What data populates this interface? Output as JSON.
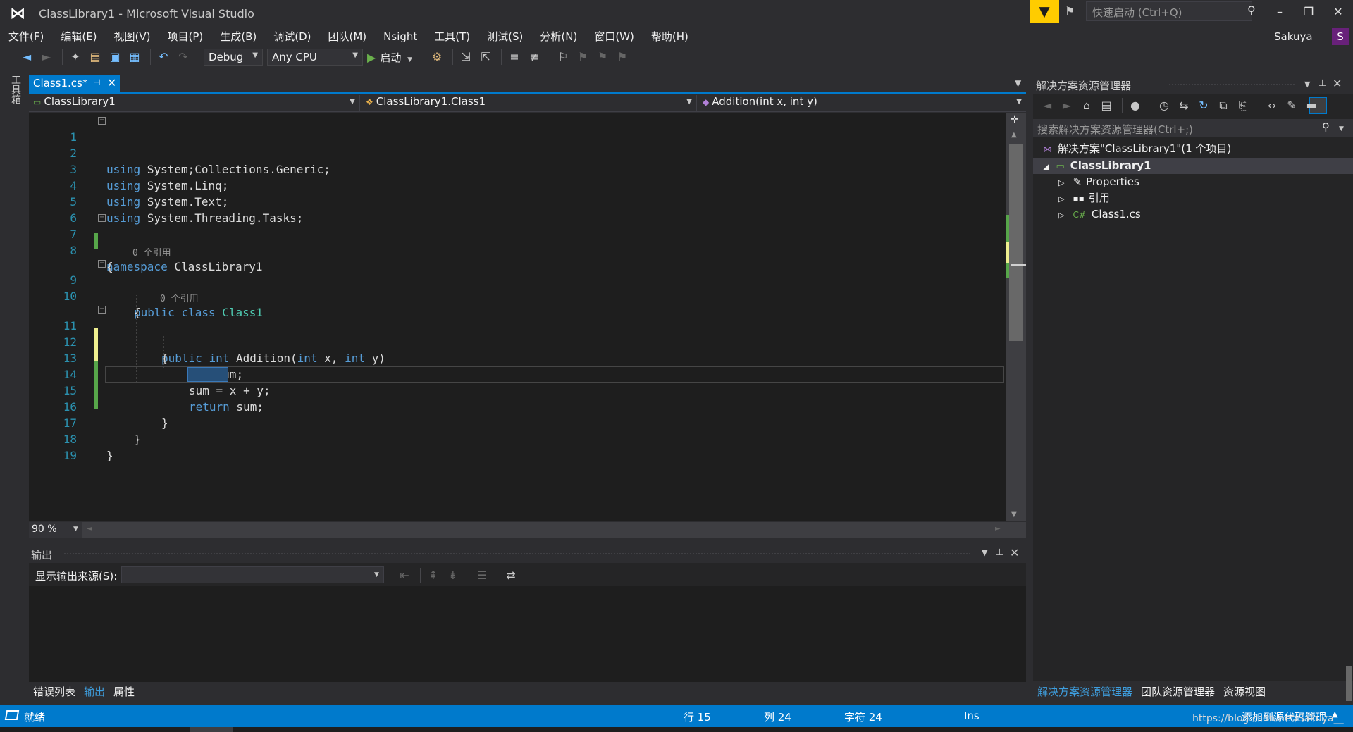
{
  "app": {
    "title": "ClassLibrary1 - Microsoft Visual Studio",
    "quick_launch_placeholder": "快速启动 (Ctrl+Q)",
    "user_name": "Sakuya",
    "user_initial": "S",
    "accent_color": "#007acc"
  },
  "menu": {
    "items": [
      "文件(F)",
      "编辑(E)",
      "视图(V)",
      "项目(P)",
      "生成(B)",
      "调试(D)",
      "团队(M)",
      "Nsight",
      "工具(T)",
      "测试(S)",
      "分析(N)",
      "窗口(W)",
      "帮助(H)"
    ]
  },
  "toolbar": {
    "configuration": "Debug",
    "platform": "Any CPU",
    "start_label": "启动"
  },
  "left_rail": {
    "toolbox_label": "工具箱"
  },
  "document": {
    "tab_label": "Class1.cs*",
    "nav_project": "ClassLibrary1",
    "nav_class": "ClassLibrary1.Class1",
    "nav_member": "Addition(int x, int y)",
    "zoom": "90 %",
    "codelens_refs": "0 个引用",
    "lines": [
      "1",
      "2",
      "3",
      "4",
      "5",
      "6",
      "7",
      "8",
      "9",
      "10",
      "11",
      "12",
      "13",
      "14",
      "15",
      "16",
      "17",
      "18",
      "19"
    ],
    "code": {
      "kw_using": "using",
      "ns_system": " System;",
      "ns_collections": " System.Collections.Generic;",
      "ns_linq": " System.Linq;",
      "ns_text": " System.Text;",
      "ns_tasks": " System.Threading.Tasks;",
      "kw_namespace": "namespace",
      "namespace_name": " ClassLibrary1",
      "open_brace": "{",
      "close_brace": "}",
      "kw_public": "public",
      "kw_class": "class",
      "class_name": "Class1",
      "kw_int": "int",
      "method_sig_1": " Addition(",
      "param_x": " x, ",
      "param_y": " y)",
      "decl_sum": " sum;",
      "assign": "sum = x + y;",
      "kw_return": "return",
      "return_tail": " sum;"
    }
  },
  "output": {
    "title": "输出",
    "source_label": "显示输出来源(S):",
    "source_value": ""
  },
  "bottom_tabs": [
    "错误列表",
    "输出",
    "属性"
  ],
  "solution_explorer": {
    "title": "解决方案资源管理器",
    "search_placeholder": "搜索解决方案资源管理器(Ctrl+;)",
    "solution_label": "解决方案\"ClassLibrary1\"(1 个项目)",
    "project_label": "ClassLibrary1",
    "items": [
      "Properties",
      "引用",
      "Class1.cs"
    ],
    "tabs": [
      "解决方案资源管理器",
      "团队资源管理器",
      "资源视图"
    ]
  },
  "statusbar": {
    "ready": "就绪",
    "line": "行 15",
    "col": "列 24",
    "char": "字符 24",
    "mode": "Ins",
    "source_control": "添加到源代码管理",
    "watermark": "https://blog.csdn.net/Sakuya__"
  }
}
